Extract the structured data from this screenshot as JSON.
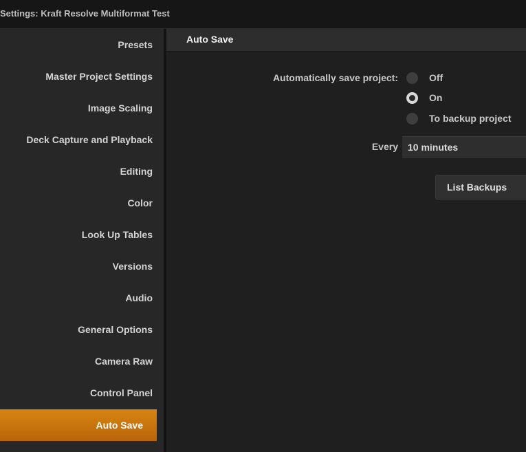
{
  "window": {
    "title": "Settings:  Kraft Resolve Multiformat Test"
  },
  "sidebar": {
    "items": [
      {
        "label": "Presets",
        "active": false
      },
      {
        "label": "Master Project Settings",
        "active": false
      },
      {
        "label": "Image Scaling",
        "active": false
      },
      {
        "label": "Deck Capture and Playback",
        "active": false
      },
      {
        "label": "Editing",
        "active": false
      },
      {
        "label": "Color",
        "active": false
      },
      {
        "label": "Look Up Tables",
        "active": false
      },
      {
        "label": "Versions",
        "active": false
      },
      {
        "label": "Audio",
        "active": false
      },
      {
        "label": "General Options",
        "active": false
      },
      {
        "label": "Camera Raw",
        "active": false
      },
      {
        "label": "Control Panel",
        "active": false
      },
      {
        "label": "Auto Save",
        "active": true
      }
    ]
  },
  "main": {
    "section_title": "Auto Save",
    "autosave_label": "Automatically save project:",
    "options": [
      {
        "label": "Off",
        "selected": false
      },
      {
        "label": "On",
        "selected": true
      },
      {
        "label": "To backup project",
        "selected": false
      }
    ],
    "every_label": "Every",
    "interval_value": "10 minutes",
    "list_backups_label": "List Backups"
  },
  "colors": {
    "accent": "#d88512",
    "background": "#1e1e1e",
    "sidebar": "#272727"
  }
}
